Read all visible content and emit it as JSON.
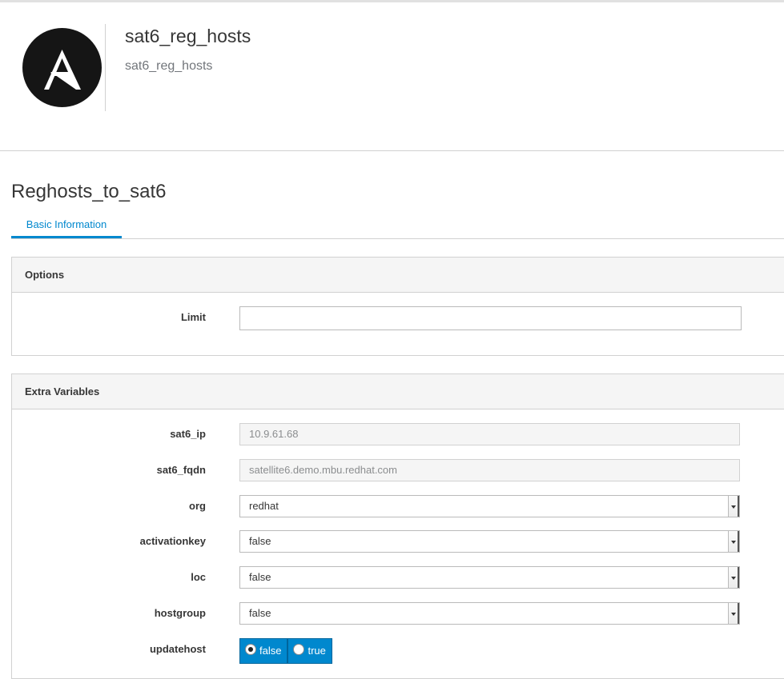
{
  "header": {
    "logo_icon": "ansible-logo-icon",
    "title": "sat6_reg_hosts",
    "subtitle": "sat6_reg_hosts"
  },
  "page": {
    "title": "Reghosts_to_sat6",
    "tabs": [
      {
        "label": "Basic Information",
        "active": true
      }
    ]
  },
  "options": {
    "heading": "Options",
    "limit": {
      "label": "Limit",
      "value": ""
    }
  },
  "extra_vars": {
    "heading": "Extra Variables",
    "sat6_ip": {
      "label": "sat6_ip",
      "value": "10.9.61.68"
    },
    "sat6_fqdn": {
      "label": "sat6_fqdn",
      "value": "satellite6.demo.mbu.redhat.com"
    },
    "org": {
      "label": "org",
      "value": "redhat"
    },
    "activationkey": {
      "label": "activationkey",
      "value": "false"
    },
    "loc": {
      "label": "loc",
      "value": "false"
    },
    "hostgroup": {
      "label": "hostgroup",
      "value": "false"
    },
    "updatehost": {
      "label": "updatehost",
      "options": [
        "false",
        "true"
      ],
      "selected": "false"
    }
  },
  "colors": {
    "accent": "#0088ce",
    "text": "#363636",
    "border": "#d1d1d1"
  }
}
